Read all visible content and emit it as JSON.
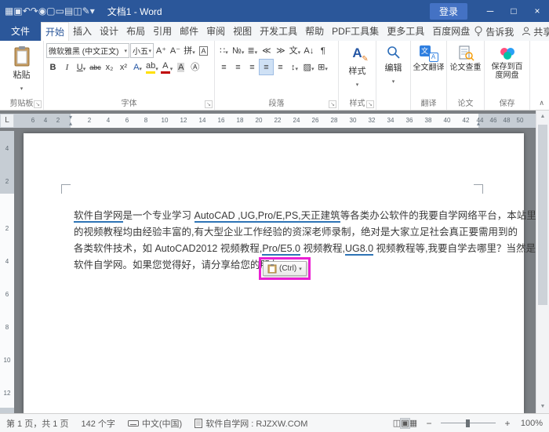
{
  "titlebar": {
    "quick_access": [
      {
        "name": "app-menu-icon",
        "glyph": "▦"
      },
      {
        "name": "save-icon",
        "glyph": "▣"
      },
      {
        "name": "undo-icon",
        "glyph": "↶"
      },
      {
        "name": "redo-icon",
        "glyph": "↷"
      },
      {
        "name": "touch-mode-icon",
        "glyph": "◉"
      },
      {
        "name": "new-document-icon",
        "glyph": "▢"
      },
      {
        "name": "open-icon",
        "glyph": "▭"
      },
      {
        "name": "quick-print-icon",
        "glyph": "▤"
      },
      {
        "name": "print-preview-icon",
        "glyph": "◫"
      },
      {
        "name": "draw-icon",
        "glyph": "✎"
      },
      {
        "name": "customize-qat-icon",
        "glyph": "▾"
      }
    ],
    "title": "文档1 - Word",
    "login_label": "登录",
    "window_controls": [
      {
        "name": "minimize-button",
        "glyph": "─"
      },
      {
        "name": "maximize-button",
        "glyph": "□"
      },
      {
        "name": "close-button",
        "glyph": "×"
      }
    ]
  },
  "tabs": [
    {
      "id": "file",
      "label": "文件",
      "state": "file"
    },
    {
      "id": "home",
      "label": "开始",
      "state": "active"
    },
    {
      "id": "insert",
      "label": "插入"
    },
    {
      "id": "design",
      "label": "设计"
    },
    {
      "id": "layout",
      "label": "布局"
    },
    {
      "id": "references",
      "label": "引用"
    },
    {
      "id": "mailings",
      "label": "邮件"
    },
    {
      "id": "review",
      "label": "审阅"
    },
    {
      "id": "view",
      "label": "视图"
    },
    {
      "id": "developer",
      "label": "开发工具"
    },
    {
      "id": "help",
      "label": "帮助"
    },
    {
      "id": "pdf-tools",
      "label": "PDF工具集"
    },
    {
      "id": "more-tools",
      "label": "更多工具"
    },
    {
      "id": "baidu-pan",
      "label": "百度网盘"
    }
  ],
  "tabs_right": {
    "tellme_label": "告诉我",
    "share_label": "共享"
  },
  "ribbon": {
    "clipboard": {
      "paste_label": "粘贴",
      "group_label": "剪贴板"
    },
    "font": {
      "name_value": "微软雅黑 (中文正文)",
      "size_value": "小五",
      "group_label": "字体",
      "row1_buttons": [
        {
          "name": "grow-font-button",
          "glyph": "A⁺"
        },
        {
          "name": "shrink-font-button",
          "glyph": "A⁻"
        },
        {
          "name": "phonetic-guide-button",
          "glyph": "拼",
          "dropdown": true
        },
        {
          "name": "character-border-button",
          "glyph": "A",
          "boxed": true
        }
      ],
      "row2_buttons": [
        {
          "name": "bold-button",
          "glyph": "B",
          "cls": "b"
        },
        {
          "name": "italic-button",
          "glyph": "I",
          "cls": "i"
        },
        {
          "name": "underline-button",
          "glyph": "U",
          "cls": "u",
          "dropdown": true
        },
        {
          "name": "strikethrough-button",
          "glyph": "abc",
          "cls": "s"
        },
        {
          "name": "subscript-button",
          "glyph": "x₂"
        },
        {
          "name": "superscript-button",
          "glyph": "x²"
        },
        {
          "name": "text-effects-button",
          "glyph": "A",
          "color": "#2456a4",
          "dropdown": true
        },
        {
          "name": "highlight-button",
          "glyph": "ab",
          "bar": "#ffe000",
          "dropdown": true
        },
        {
          "name": "font-color-button",
          "glyph": "A",
          "bar": "#c00000",
          "dropdown": true
        },
        {
          "name": "char-shading-button",
          "glyph": "A",
          "cls": "shade"
        },
        {
          "name": "enclose-character-button",
          "glyph": "Ⓐ"
        }
      ]
    },
    "paragraph": {
      "group_label": "段落",
      "row1_buttons": [
        {
          "name": "bullets-button",
          "glyph": "∷",
          "dropdown": true
        },
        {
          "name": "numbering-button",
          "glyph": "№",
          "dropdown": true
        },
        {
          "name": "multilevel-list-button",
          "glyph": "≣",
          "dropdown": true
        },
        {
          "name": "decrease-indent-button",
          "glyph": "≪"
        },
        {
          "name": "increase-indent-button",
          "glyph": "≫"
        },
        {
          "name": "asian-layout-button",
          "glyph": "文",
          "dropdown": true
        },
        {
          "name": "sort-button",
          "glyph": "A↓"
        },
        {
          "name": "show-marks-button",
          "glyph": "¶"
        }
      ],
      "row2_buttons": [
        {
          "name": "align-left-button",
          "glyph": "≡"
        },
        {
          "name": "align-center-button",
          "glyph": "≡"
        },
        {
          "name": "align-right-button",
          "glyph": "≡"
        },
        {
          "name": "justify-button",
          "glyph": "≡",
          "selected": true
        },
        {
          "name": "distribute-button",
          "glyph": "≡"
        },
        {
          "name": "line-spacing-button",
          "glyph": "↕",
          "dropdown": true
        },
        {
          "name": "shading-button",
          "glyph": "▨",
          "dropdown": true
        },
        {
          "name": "borders-button",
          "glyph": "⊞",
          "dropdown": true
        }
      ]
    },
    "styles": {
      "button_label": "样式",
      "group_label": "样式"
    },
    "editing": {
      "button_label": "编辑"
    },
    "translate": {
      "button_label": "全文翻译",
      "group_label": "翻译"
    },
    "paper": {
      "button_label": "论文查重",
      "group_label": "论文"
    },
    "baidu": {
      "button_label": "保存到百度网盘",
      "group_label": "保存"
    },
    "launcher_glyph": "↘",
    "collapse_glyph": "∧"
  },
  "ruler": {
    "tab_selector": "L",
    "h_left": [
      "6",
      "4",
      "2"
    ],
    "h_main": [
      "2",
      "4",
      "6",
      "8",
      "10",
      "12",
      "14",
      "16",
      "18",
      "20",
      "22",
      "24",
      "26",
      "28",
      "30",
      "32",
      "34",
      "36",
      "38",
      "40",
      "42"
    ],
    "h_right": [
      "44",
      "46",
      "48",
      "50"
    ],
    "v_top": [
      "4",
      "2"
    ],
    "v_main": [
      "2",
      "4",
      "6",
      "8",
      "10",
      "12"
    ]
  },
  "document": {
    "lines": [
      [
        {
          "t": "软件自学网",
          "u": true
        },
        {
          "t": "是一个专业学习 "
        },
        {
          "t": "AutoCAD ,UG,Pro/E,PS,",
          "u": true
        },
        {
          "t": "天正建筑",
          "u": true
        },
        {
          "t": "等各类办公软件的我要自学网络平台，本站里"
        }
      ],
      [
        {
          "t": "的视频教程均由经验丰富的,有大型企业工作经验的资深老师录制，绝对是大家立足社会真正要需用到的"
        }
      ],
      [
        {
          "t": "各类软件技术，如 AutoCAD2012 视频教程,"
        },
        {
          "t": "Pro/E5.0",
          "u": true
        },
        {
          "t": " 视频教程,"
        },
        {
          "t": "UG8.0",
          "u": true
        },
        {
          "t": " 视频教程等,我要自学去哪里？当然是"
        }
      ],
      [
        {
          "t": "软件自学网。如果您觉得好，请分享给您的朋友。"
        }
      ]
    ],
    "paste_options_label": "(Ctrl)"
  },
  "statusbar": {
    "page_info": "第 1 页，共 1 页",
    "word_count": "142 个字",
    "language": "中文(中国)",
    "site": "软件自学网 : RJZXW.COM",
    "view_buttons": [
      {
        "name": "read-mode-button",
        "glyph": "◫"
      },
      {
        "name": "print-layout-button",
        "glyph": "▣",
        "selected": true
      },
      {
        "name": "web-layout-button",
        "glyph": "▦"
      }
    ],
    "zoom_level": "100%"
  }
}
